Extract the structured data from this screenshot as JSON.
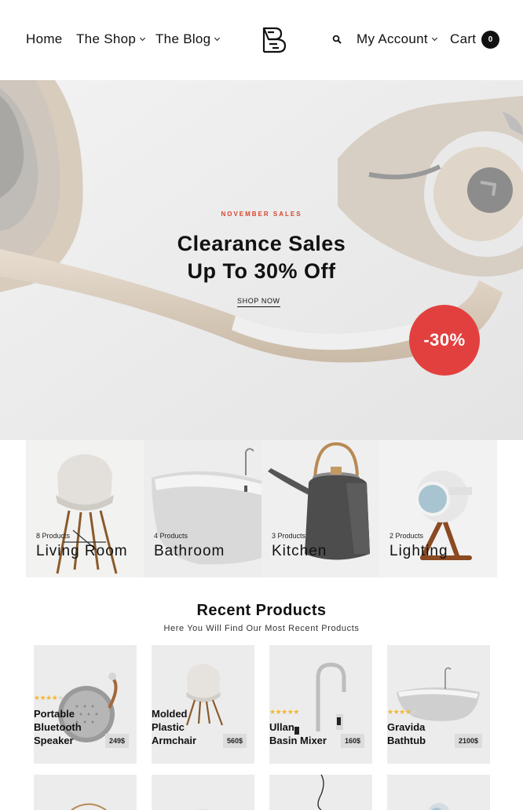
{
  "header": {
    "nav": [
      {
        "label": "Home"
      },
      {
        "label": "The Shop"
      },
      {
        "label": "The Blog"
      }
    ],
    "account_label": "My Account",
    "cart_label": "Cart",
    "cart_count": "0"
  },
  "hero": {
    "eyebrow": "NOVEMBER SALES",
    "title_line1": "Clearance Sales",
    "title_line2": "Up To 30% Off",
    "cta": "SHOP NOW",
    "discount_badge": "-30%"
  },
  "categories": [
    {
      "count": "8 Products",
      "name": "Living Room"
    },
    {
      "count": "4 Products",
      "name": "Bathroom"
    },
    {
      "count": "3 Products",
      "name": "Kitchen"
    },
    {
      "count": "2 Products",
      "name": "Lighting"
    }
  ],
  "recent": {
    "title": "Recent Products",
    "subtitle": "Here You Will Find Our Most Recent Products",
    "products": [
      {
        "name_lines": [
          "Portable",
          "Bluetooth",
          "Speaker"
        ],
        "price": "249$",
        "rating": 3.5
      },
      {
        "name_lines": [
          "Molded",
          "Plastic",
          "Armchair"
        ],
        "price": "560$",
        "rating": 0
      },
      {
        "name_lines": [
          "Ullan",
          "Basin Mixer"
        ],
        "price": "160$",
        "rating": 4.5
      },
      {
        "name_lines": [
          "Gravida",
          "Bathtub"
        ],
        "price": "2100$",
        "rating": 3.5
      }
    ]
  },
  "colors": {
    "accent": "#d6442c",
    "badge": "#e2403e",
    "star": "#f2b634"
  },
  "icons": [
    "logo-icon",
    "search-icon",
    "chevron-down-icon"
  ]
}
